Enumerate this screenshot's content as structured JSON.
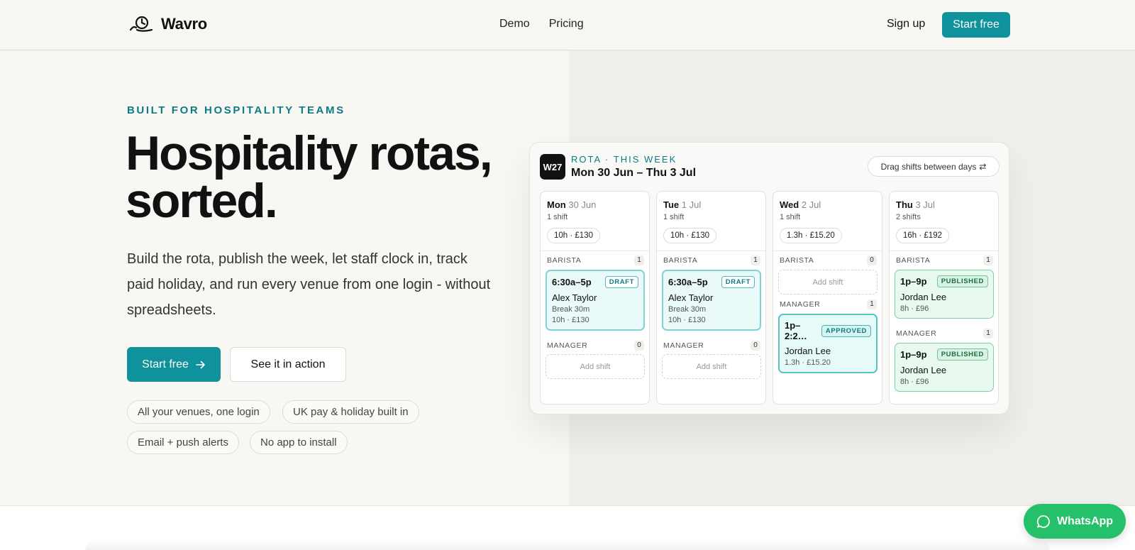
{
  "header": {
    "brand": "Wavro",
    "nav": [
      "Demo",
      "Pricing"
    ],
    "signup": "Sign up",
    "cta": "Start free"
  },
  "hero": {
    "eyebrow": "BUILT FOR HOSPITALITY TEAMS",
    "title_line1": "Hospitality rotas,",
    "title_line2": "sorted.",
    "lead": "Build the rota, publish the week, let staff clock in, track paid holiday, and run every venue from one login - without spreadsheets.",
    "primary_cta": "Start free",
    "secondary_cta": "See it in action",
    "pills": [
      "All your venues, one login",
      "UK pay & holiday built in",
      "Email + push alerts",
      "No app to install"
    ]
  },
  "rota": {
    "badge": "W27",
    "eyebrow": "ROTA · THIS WEEK",
    "title": "Mon 30 Jun – Thu 3 Jul",
    "hint": "Drag shifts between days",
    "add_shift_label": "Add shift",
    "days": [
      {
        "name": "Mon",
        "date": "30 Jun",
        "count": "1 shift",
        "total": "10h · £130",
        "roles": [
          {
            "label": "BARISTA",
            "count": "1",
            "shift": {
              "time": "6:30a–5p",
              "status": "DRAFT",
              "name": "Alex Taylor",
              "break": "Break 30m",
              "meta": "10h · £130"
            }
          },
          {
            "label": "MANAGER",
            "count": "0"
          }
        ]
      },
      {
        "name": "Tue",
        "date": "1 Jul",
        "count": "1 shift",
        "total": "10h · £130",
        "roles": [
          {
            "label": "BARISTA",
            "count": "1",
            "shift": {
              "time": "6:30a–5p",
              "status": "DRAFT",
              "name": "Alex Taylor",
              "break": "Break 30m",
              "meta": "10h · £130"
            }
          },
          {
            "label": "MANAGER",
            "count": "0"
          }
        ]
      },
      {
        "name": "Wed",
        "date": "2 Jul",
        "count": "1 shift",
        "total": "1.3h · £15.20",
        "roles": [
          {
            "label": "BARISTA",
            "count": "0"
          },
          {
            "label": "MANAGER",
            "count": "1",
            "shift": {
              "time": "1p–2:2…",
              "status": "APPROVED",
              "name": "Jordan Lee",
              "meta": "1.3h · £15.20"
            }
          }
        ]
      },
      {
        "name": "Thu",
        "date": "3 Jul",
        "count": "2 shifts",
        "total": "16h · £192",
        "roles": [
          {
            "label": "BARISTA",
            "count": "1",
            "shift": {
              "time": "1p–9p",
              "status": "PUBLISHED",
              "name": "Jordan Lee",
              "meta": "8h · £96"
            }
          },
          {
            "label": "MANAGER",
            "count": "1",
            "shift": {
              "time": "1p–9p",
              "status": "PUBLISHED",
              "name": "Jordan Lee",
              "meta": "8h · £96"
            }
          }
        ]
      }
    ]
  },
  "whatsapp": "WhatsApp",
  "colors": {
    "accent": "#0f929b",
    "accent_text": "#0d7b82",
    "whatsapp": "#25c06a"
  }
}
